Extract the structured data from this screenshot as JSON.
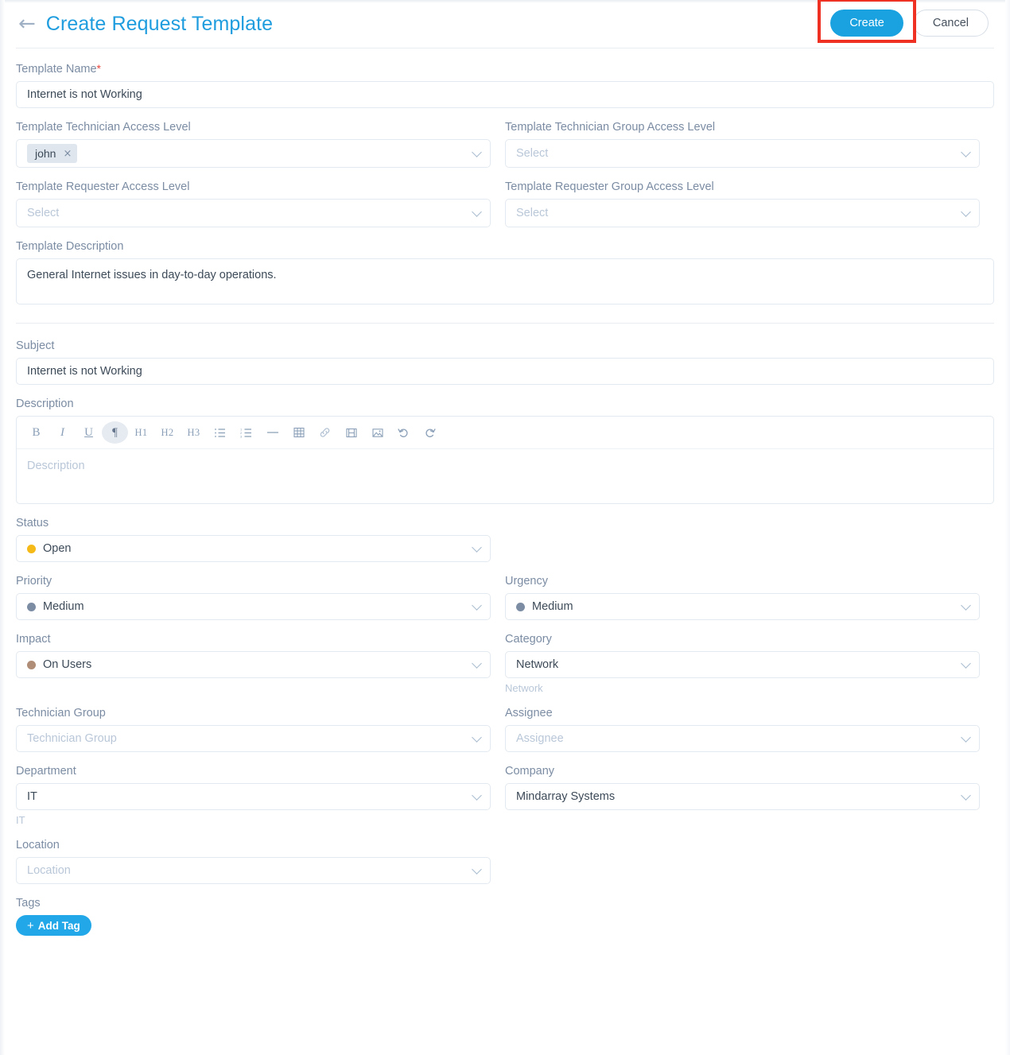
{
  "header": {
    "back_icon": "arrow-left-icon",
    "title": "Create Request Template",
    "create_label": "Create",
    "cancel_label": "Cancel",
    "highlight_color": "#ef3124",
    "accent_color": "#1f9dde"
  },
  "form": {
    "template_name": {
      "label": "Template Name",
      "required_mark": "*",
      "value": "Internet is not Working"
    },
    "technician_access": {
      "label": "Template Technician Access Level",
      "chip": "john",
      "chip_remove_icon": "×"
    },
    "technician_group_access": {
      "label": "Template Technician Group Access Level",
      "placeholder": "Select"
    },
    "requester_access": {
      "label": "Template Requester Access Level",
      "placeholder": "Select"
    },
    "requester_group_access": {
      "label": "Template Requester Group Access Level",
      "placeholder": "Select"
    },
    "template_description": {
      "label": "Template Description",
      "value": "General Internet issues in day-to-day operations."
    },
    "subject": {
      "label": "Subject",
      "value": "Internet is not Working"
    },
    "description": {
      "label": "Description",
      "placeholder": "Description",
      "toolbar": [
        {
          "name": "bold-icon",
          "glyph": "B",
          "active": false
        },
        {
          "name": "italic-icon",
          "glyph": "I",
          "active": false
        },
        {
          "name": "underline-icon",
          "glyph": "U",
          "active": false
        },
        {
          "name": "paragraph-icon",
          "glyph": "¶",
          "active": true
        },
        {
          "name": "heading-1-icon",
          "glyph": "H1",
          "active": false
        },
        {
          "name": "heading-2-icon",
          "glyph": "H2",
          "active": false
        },
        {
          "name": "heading-3-icon",
          "glyph": "H3",
          "active": false
        },
        {
          "name": "bullet-list-icon",
          "glyph": "",
          "active": false
        },
        {
          "name": "numbered-list-icon",
          "glyph": "",
          "active": false
        },
        {
          "name": "horizontal-rule-icon",
          "glyph": "",
          "active": false
        },
        {
          "name": "table-icon",
          "glyph": "",
          "active": false
        },
        {
          "name": "link-icon",
          "glyph": "",
          "active": false
        },
        {
          "name": "video-icon",
          "glyph": "",
          "active": false
        },
        {
          "name": "image-icon",
          "glyph": "",
          "active": false
        },
        {
          "name": "undo-icon",
          "glyph": "",
          "active": false
        },
        {
          "name": "redo-icon",
          "glyph": "",
          "active": false
        }
      ]
    },
    "status": {
      "label": "Status",
      "value": "Open",
      "dot_color": "#f5ba18"
    },
    "priority": {
      "label": "Priority",
      "value": "Medium",
      "dot_color": "#7b8ca3"
    },
    "urgency": {
      "label": "Urgency",
      "value": "Medium",
      "dot_color": "#7b8ca3"
    },
    "impact": {
      "label": "Impact",
      "value": "On Users",
      "dot_color": "#b08d76"
    },
    "category": {
      "label": "Category",
      "value": "Network",
      "helper": "Network"
    },
    "technician_group": {
      "label": "Technician Group",
      "placeholder": "Technician Group"
    },
    "assignee": {
      "label": "Assignee",
      "placeholder": "Assignee"
    },
    "department": {
      "label": "Department",
      "value": "IT",
      "helper": "IT"
    },
    "company": {
      "label": "Company",
      "value": "Mindarray Systems"
    },
    "location": {
      "label": "Location",
      "placeholder": "Location"
    },
    "tags": {
      "label": "Tags",
      "add_label": "Add Tag",
      "plus_glyph": "+"
    }
  }
}
